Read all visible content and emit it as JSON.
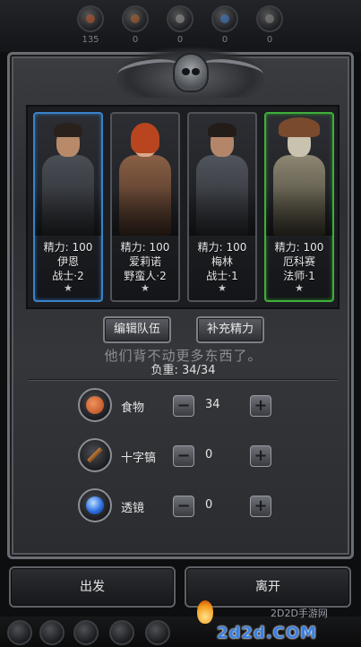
{
  "resources": [
    {
      "icon": "meat-resource-icon",
      "count": "135",
      "color": "#c25a2a"
    },
    {
      "icon": "wood-resource-icon",
      "count": "0",
      "color": "#b7622c"
    },
    {
      "icon": "pickaxe-resource-icon",
      "count": "0",
      "color": "#9a9a9a"
    },
    {
      "icon": "gem-resource-icon",
      "count": "0",
      "color": "#3c7fd6"
    },
    {
      "icon": "tool-resource-icon",
      "count": "0",
      "color": "#8a8a8a"
    }
  ],
  "heroes": [
    {
      "energy": "精力: 100",
      "name": "伊恩",
      "class": "战士·2",
      "star": "★",
      "border": "blue"
    },
    {
      "energy": "精力: 100",
      "name": "爱莉诺",
      "class": "野蛮人·2",
      "star": "★",
      "border": "gray"
    },
    {
      "energy": "精力: 100",
      "name": "梅林",
      "class": "战士·1",
      "star": "★",
      "border": "gray"
    },
    {
      "energy": "精力: 100",
      "name": "厄科赛",
      "class": "法师·1",
      "star": "★",
      "border": "green"
    }
  ],
  "buttons": {
    "edit_team": "编辑队伍",
    "refill_energy": "补充精力"
  },
  "overlay_message": "他们背不动更多东西了。",
  "load": "负重:  34/34",
  "items": [
    {
      "name": "食物",
      "qty": "34",
      "icon": "food-icon"
    },
    {
      "name": "十字镐",
      "qty": "0",
      "icon": "pickaxe-icon"
    },
    {
      "name": "透镜",
      "qty": "0",
      "icon": "lens-icon"
    }
  ],
  "stepper": {
    "minus": "−",
    "plus": "+"
  },
  "actions": {
    "depart": "出发",
    "leave": "离开"
  },
  "watermark": {
    "site": "2D2D手游网",
    "domain": "2d2d.COM"
  },
  "colors": {
    "blue_border": "#3a82c7",
    "green_border": "#3fae3c"
  }
}
